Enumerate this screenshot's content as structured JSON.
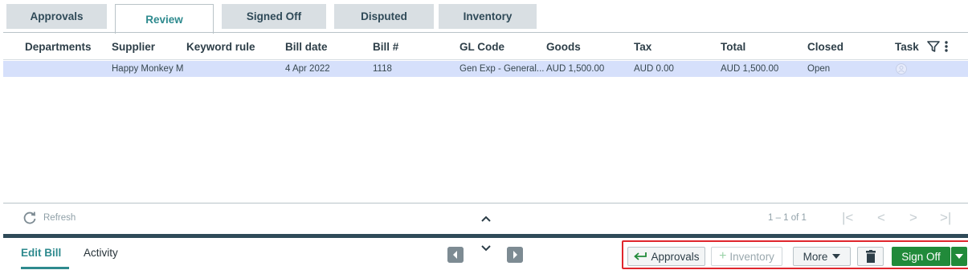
{
  "tabs": [
    {
      "label": "Approvals",
      "active": false
    },
    {
      "label": "Review",
      "active": true
    },
    {
      "label": "Signed Off",
      "active": false
    },
    {
      "label": "Disputed",
      "active": false
    },
    {
      "label": "Inventory",
      "active": false
    }
  ],
  "grid": {
    "columns": [
      "Departments",
      "Supplier",
      "Keyword rule",
      "Bill date",
      "Bill #",
      "GL Code",
      "Goods",
      "Tax",
      "Total",
      "Closed",
      "Task"
    ],
    "rows": [
      {
        "departments": "",
        "supplier": "Happy Monkey M...",
        "keyword_rule": "",
        "bill_date": "4 Apr 2022",
        "bill_no": "1118",
        "gl_code": "Gen Exp - General...",
        "goods": "AUD 1,500.00",
        "tax": "AUD 0.00",
        "total": "AUD 1,500.00",
        "closed": "Open",
        "task_icon": "user-icon"
      }
    ],
    "selected_row_color": "#d6e0fb"
  },
  "footer": {
    "refresh_label": "Refresh",
    "page_info": "1 – 1 of 1",
    "pager": {
      "first": "|<",
      "prev": "<",
      "next": ">",
      "last": ">|"
    }
  },
  "bottom_tabs": {
    "edit_bill": "Edit Bill",
    "activity": "Activity"
  },
  "actions": {
    "approvals": "Approvals",
    "inventory": "Inventory",
    "more": "More",
    "sign_off": "Sign Off"
  },
  "colors": {
    "accent": "#2e8a8e",
    "sign_off_green": "#218a3a",
    "highlight_red": "#e0262d",
    "dark_bar": "#2f4a58"
  }
}
